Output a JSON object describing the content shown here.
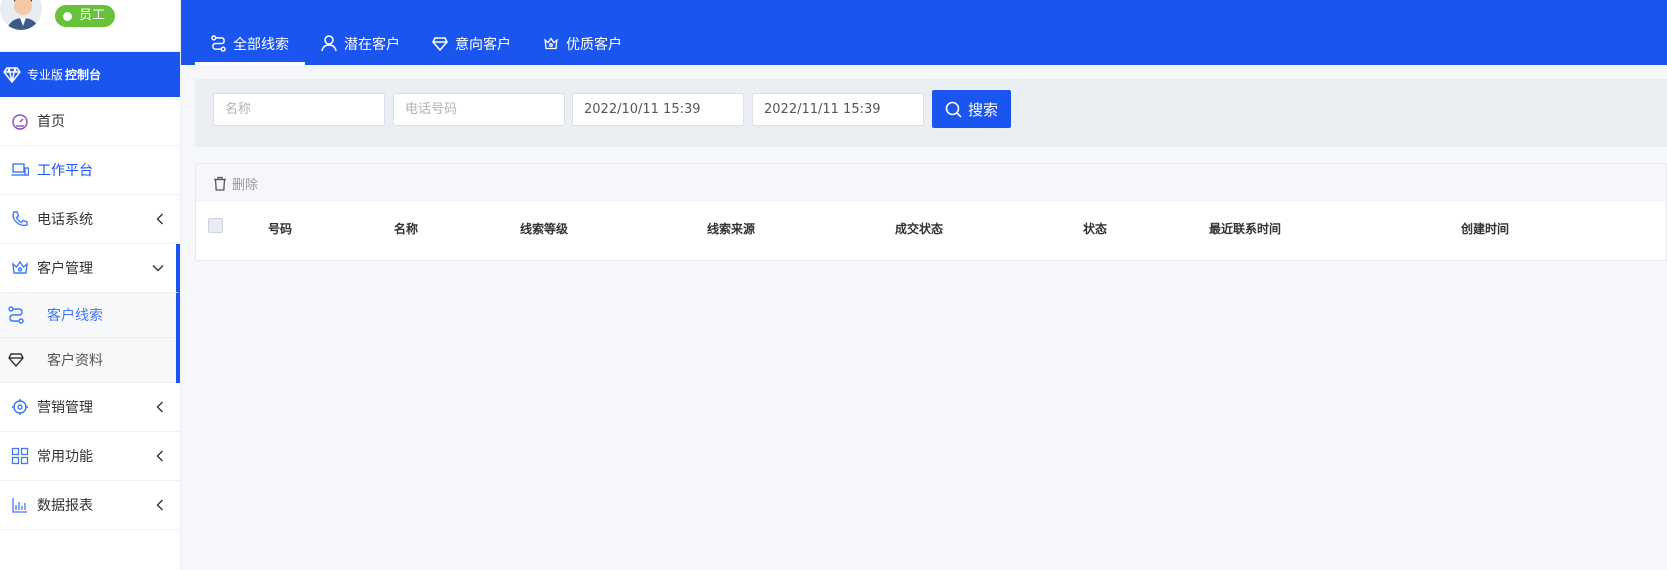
{
  "user": {
    "role_label": "员工"
  },
  "console": {
    "prefix": "专业版",
    "title": "控制台"
  },
  "menu": {
    "home": "首页",
    "workbench": "工作平台",
    "phone": "电话系统",
    "customer_mgmt": "客户管理",
    "sub_leads": "客户线索",
    "sub_profile": "客户资料",
    "marketing": "营销管理",
    "common": "常用功能",
    "reports": "数据报表"
  },
  "tabs": {
    "all_leads": "全部线索",
    "potential": "潜在客户",
    "intent": "意向客户",
    "quality": "优质客户"
  },
  "filters": {
    "name_placeholder": "名称",
    "phone_placeholder": "电话号码",
    "start_date": "2022/10/11 15:39",
    "end_date": "2022/11/11 15:39",
    "search_label": "搜索"
  },
  "toolbar": {
    "delete_label": "删除"
  },
  "table": {
    "columns": {
      "number": "号码",
      "name": "名称",
      "level": "线索等级",
      "source": "线索来源",
      "deal": "成交状态",
      "status": "状态",
      "last_contact": "最近联系时间",
      "created": "创建时间"
    }
  },
  "colors": {
    "primary": "#1a55f0",
    "badge": "#67c23a",
    "sub_active": "#3f78f6"
  }
}
